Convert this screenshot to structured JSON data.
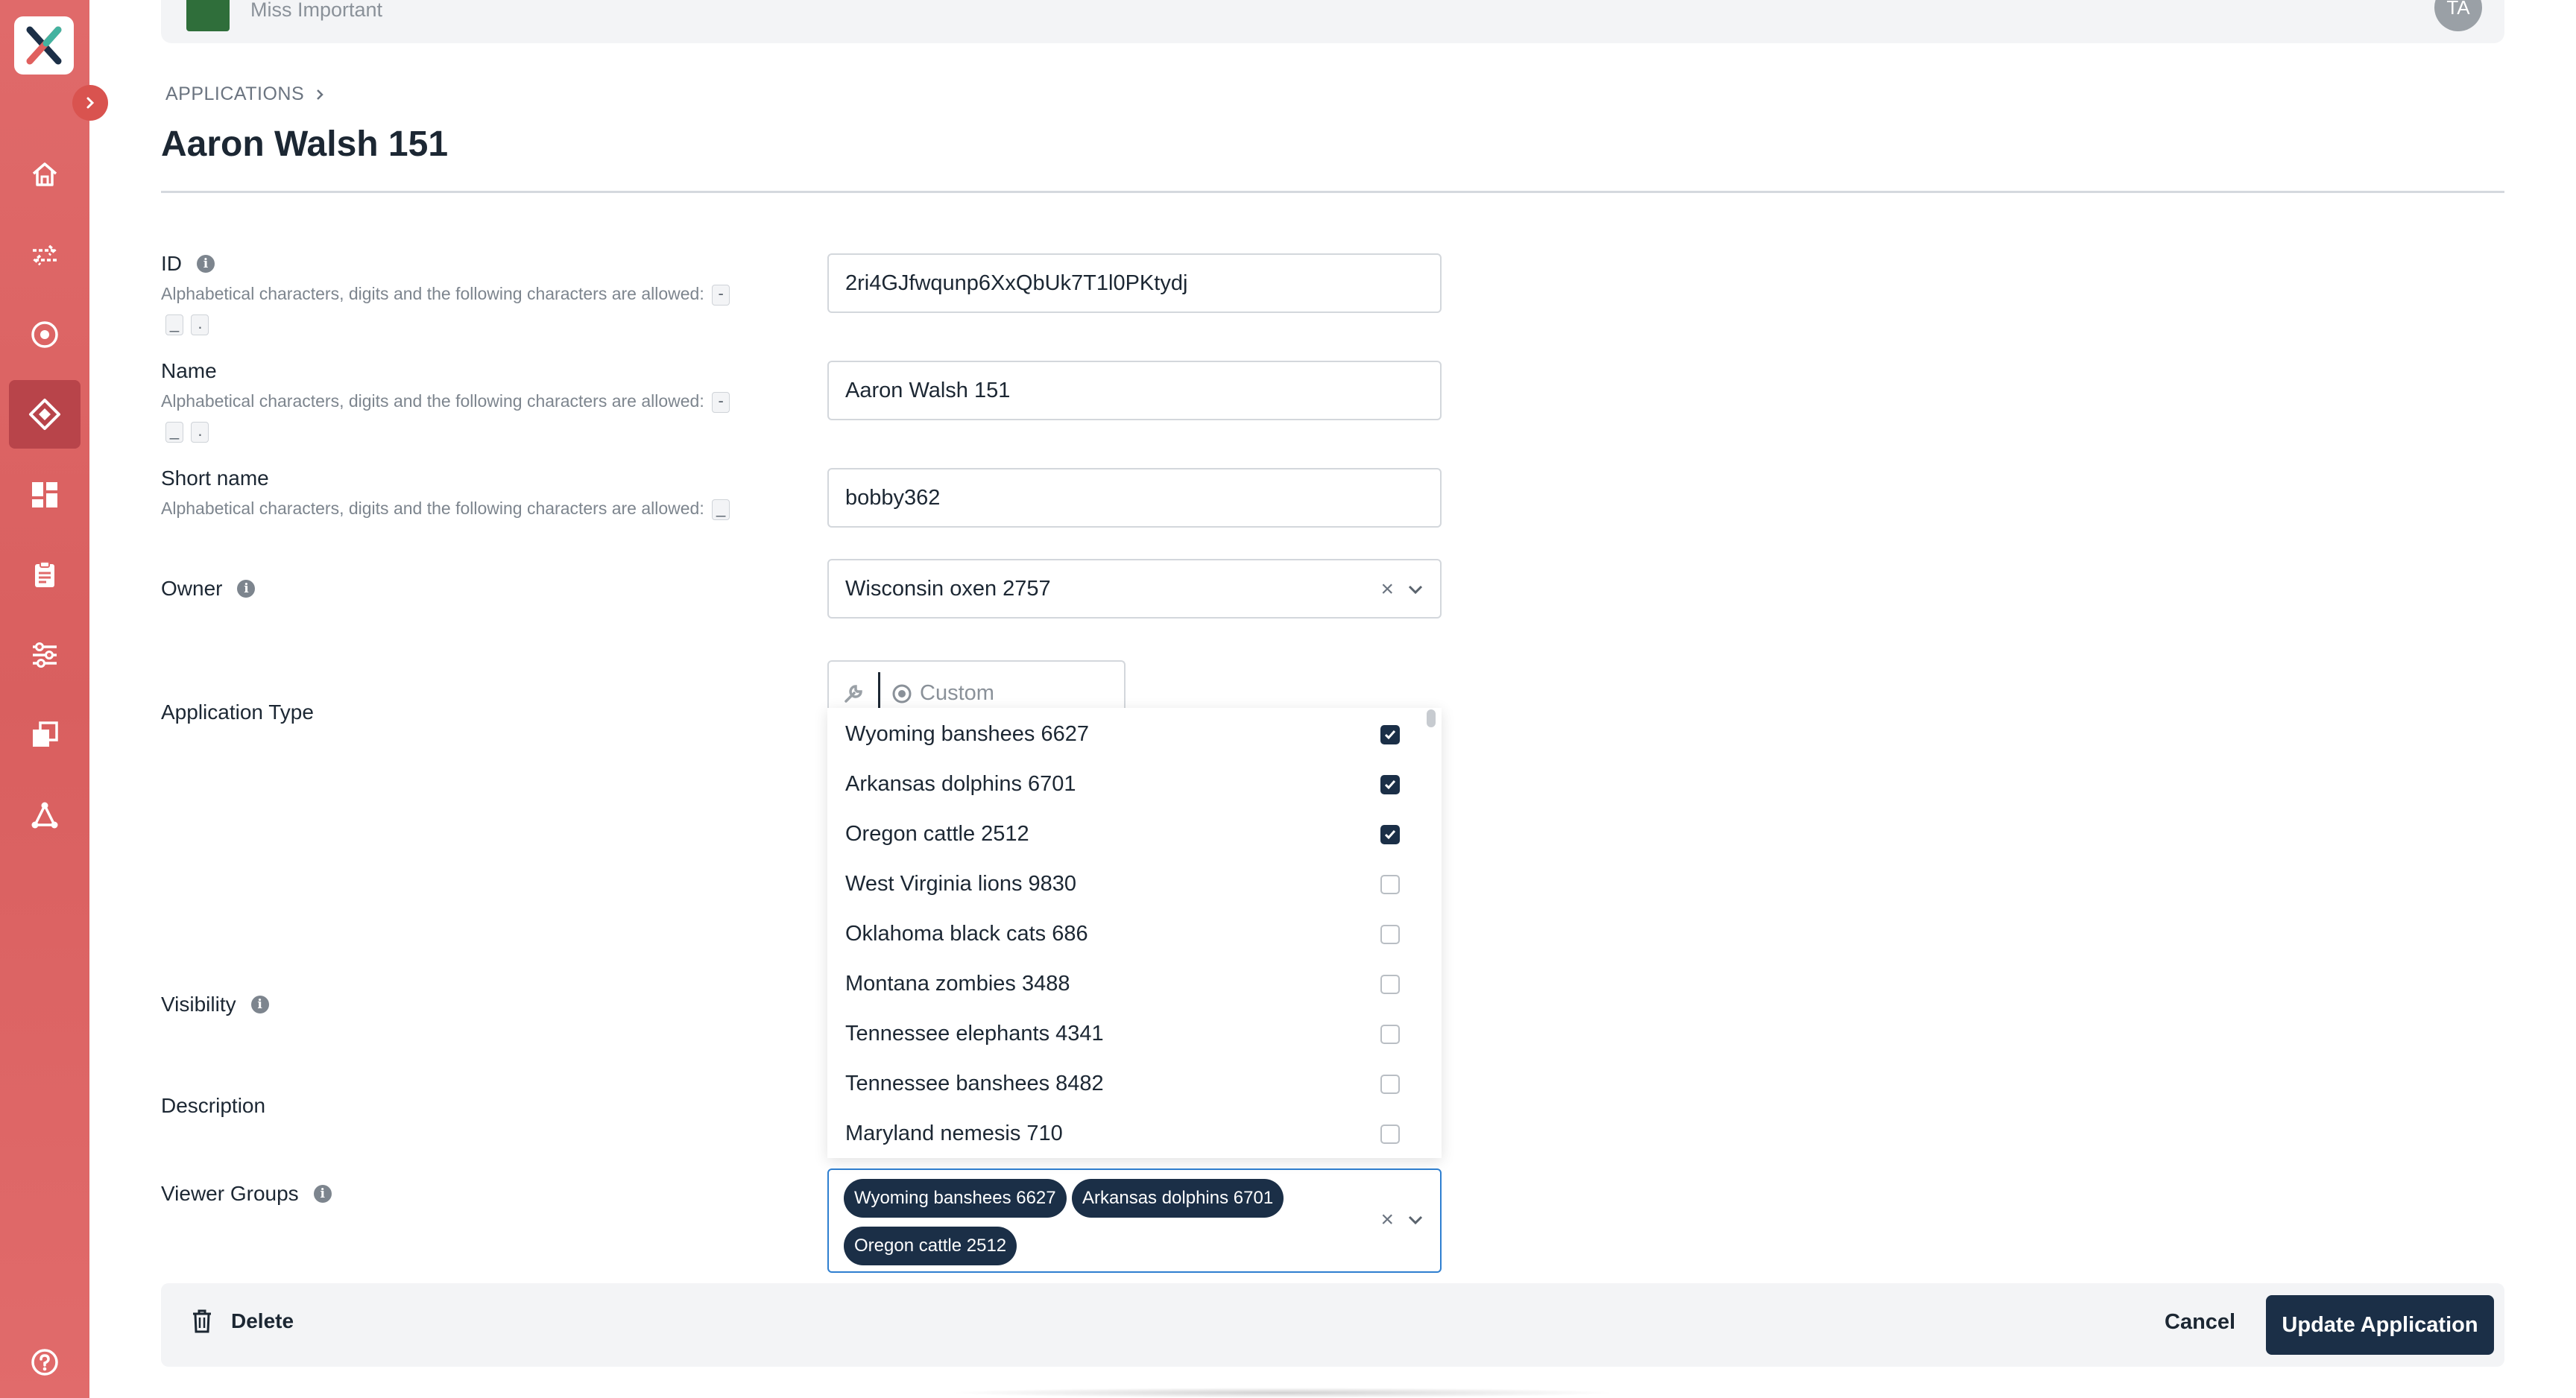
{
  "topbar": {
    "user_name": "Miss Important",
    "user_initials": "TA"
  },
  "breadcrumb": {
    "label": "APPLICATIONS"
  },
  "page": {
    "title": "Aaron Walsh 151"
  },
  "form": {
    "id": {
      "label": "ID",
      "hint": "Alphabetical characters, digits and the following characters are allowed:",
      "allowed": [
        "-",
        "_",
        "."
      ],
      "value": "2ri4GJfwqunp6XxQbUk7T1l0PKtydj"
    },
    "name": {
      "label": "Name",
      "hint": "Alphabetical characters, digits and the following characters are allowed:",
      "allowed": [
        "-",
        "_",
        "."
      ],
      "value": "Aaron Walsh 151"
    },
    "short_name": {
      "label": "Short name",
      "hint": "Alphabetical characters, digits and the following characters are allowed:",
      "allowed": [
        "_"
      ],
      "value": "bobby362"
    },
    "owner": {
      "label": "Owner",
      "value": "Wisconsin oxen 2757"
    },
    "application_type": {
      "label": "Application Type",
      "option_custom": "Custom"
    },
    "visibility": {
      "label": "Visibility"
    },
    "description": {
      "label": "Description"
    },
    "viewer_groups": {
      "label": "Viewer Groups",
      "selected": [
        "Wyoming banshees 6627",
        "Arkansas dolphins 6701",
        "Oregon cattle 2512"
      ]
    }
  },
  "dropdown": {
    "options": [
      {
        "label": "Wyoming banshees 6627",
        "checked": true
      },
      {
        "label": "Arkansas dolphins 6701",
        "checked": true
      },
      {
        "label": "Oregon cattle 2512",
        "checked": true
      },
      {
        "label": "West Virginia lions 9830",
        "checked": false
      },
      {
        "label": "Oklahoma black cats 686",
        "checked": false
      },
      {
        "label": "Montana zombies 3488",
        "checked": false
      },
      {
        "label": "Tennessee elephants 4341",
        "checked": false
      },
      {
        "label": "Tennessee banshees 8482",
        "checked": false
      },
      {
        "label": "Maryland nemesis 710",
        "checked": false
      }
    ]
  },
  "footer": {
    "delete_label": "Delete",
    "cancel_label": "Cancel",
    "update_label": "Update Application"
  },
  "icons": {
    "sidebar": [
      "home-icon",
      "transfer-icon",
      "target-icon",
      "applications-icon",
      "dashboard-icon",
      "clipboard-icon",
      "sliders-icon",
      "copy-icon",
      "network-icon",
      "help-icon"
    ]
  },
  "colors": {
    "sidebar": "#e06a6a",
    "primary": "#1b2f47",
    "focus": "#2f7fd0"
  }
}
